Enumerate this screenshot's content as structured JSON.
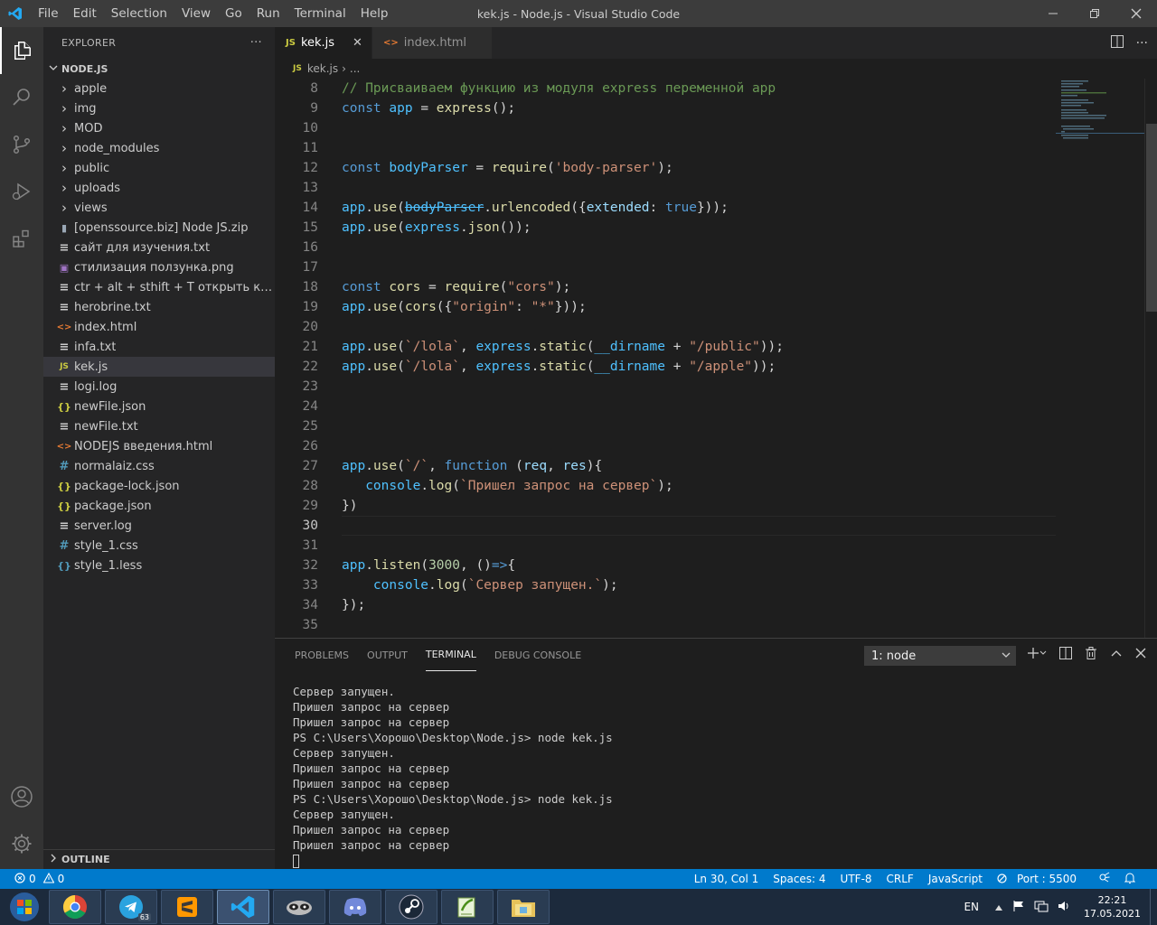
{
  "titlebar": {
    "menu": [
      "File",
      "Edit",
      "Selection",
      "View",
      "Go",
      "Run",
      "Terminal",
      "Help"
    ],
    "title": "kek.js - Node.js - Visual Studio Code"
  },
  "sidebar": {
    "header": "EXPLORER",
    "more": "···",
    "section": "NODE.JS",
    "items": [
      {
        "label": "apple",
        "type": "folder"
      },
      {
        "label": "img",
        "type": "folder"
      },
      {
        "label": "MOD",
        "type": "folder"
      },
      {
        "label": "node_modules",
        "type": "folder"
      },
      {
        "label": "public",
        "type": "folder"
      },
      {
        "label": "uploads",
        "type": "folder"
      },
      {
        "label": "views",
        "type": "folder"
      },
      {
        "label": "[openssource.biz] Node JS.zip",
        "type": "zip"
      },
      {
        "label": "сайт для изучения.txt",
        "type": "txt"
      },
      {
        "label": "стилизация ползунка.png",
        "type": "png"
      },
      {
        "label": "ctr + alt + sthift + T открыть консол...",
        "type": "txt"
      },
      {
        "label": "herobrine.txt",
        "type": "txt"
      },
      {
        "label": "index.html",
        "type": "html"
      },
      {
        "label": "infa.txt",
        "type": "txt"
      },
      {
        "label": "kek.js",
        "type": "js"
      },
      {
        "label": "logi.log",
        "type": "txt"
      },
      {
        "label": "newFile.json",
        "type": "json"
      },
      {
        "label": "newFile.txt",
        "type": "txt"
      },
      {
        "label": "NODEJS введения.html",
        "type": "html"
      },
      {
        "label": "normalaiz.css",
        "type": "css"
      },
      {
        "label": "package-lock.json",
        "type": "json"
      },
      {
        "label": "package.json",
        "type": "json"
      },
      {
        "label": "server.log",
        "type": "txt"
      },
      {
        "label": "style_1.css",
        "type": "css"
      },
      {
        "label": "style_1.less",
        "type": "less"
      }
    ],
    "outline": "OUTLINE"
  },
  "tabs": [
    {
      "label": "kek.js",
      "icon": "JS",
      "close": "✕"
    },
    {
      "label": "index.html",
      "icon": "<>"
    }
  ],
  "breadcrumb": {
    "icon": "JS",
    "file": "kek.js",
    "rest": "..."
  },
  "code_lines": {
    "l8": "// Присваиваем функцию из модуля express переменной app",
    "l27s": "Пришел запрос на сервер",
    "l33s": "Сервер запущен."
  },
  "line_numbers": [
    "8",
    "9",
    "10",
    "11",
    "12",
    "13",
    "14",
    "15",
    "16",
    "17",
    "18",
    "19",
    "20",
    "21",
    "22",
    "23",
    "24",
    "25",
    "26",
    "27",
    "28",
    "29",
    "30",
    "31",
    "32",
    "33",
    "34",
    "35"
  ],
  "panel": {
    "tabs": [
      "PROBLEMS",
      "OUTPUT",
      "TERMINAL",
      "DEBUG CONSOLE"
    ],
    "terminal_select": "1: node",
    "terminal_lines": [
      "Сервер запущен.",
      "Пришел запрос на сервер",
      "Пришел запрос на сервер",
      "PS C:\\Users\\Хорошо\\Desktop\\Node.js> node kek.js",
      "Сервер запущен.",
      "Пришел запрос на сервер",
      "Пришел запрос на сервер",
      "PS C:\\Users\\Хорошо\\Desktop\\Node.js> node kek.js",
      "Сервер запущен.",
      "Пришел запрос на сервер",
      "Пришел запрос на сервер"
    ]
  },
  "status": {
    "errors": "0",
    "warnings": "0",
    "right": [
      "Ln 30, Col 1",
      "Spaces: 4",
      "UTF-8",
      "CRLF",
      "JavaScript",
      "Port : 5500"
    ]
  },
  "taskbar": {
    "lang": "EN",
    "time": "22:21",
    "date": "17.05.2021",
    "telegram_badge": "63"
  }
}
